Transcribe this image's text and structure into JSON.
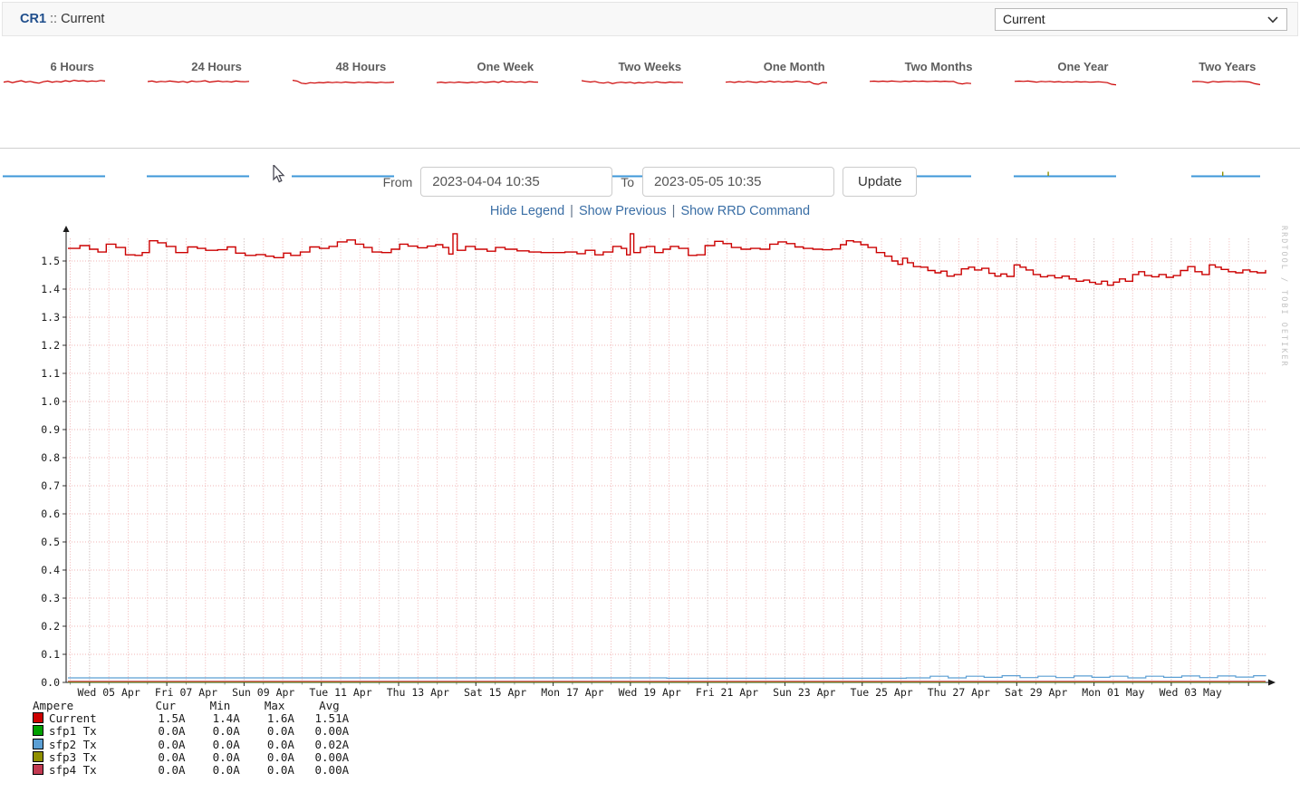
{
  "header": {
    "device": "CR1",
    "sep": "::",
    "page": "Current",
    "range_select_value": "Current"
  },
  "thumbnails": {
    "items": [
      {
        "label": "6 Hours",
        "start_frac": 0,
        "olive_tick": null,
        "spark": [
          0.45,
          0.52,
          0.4,
          0.5,
          0.58,
          0.45,
          0.52,
          0.42,
          0.35,
          0.48,
          0.55,
          0.44,
          0.52,
          0.46,
          0.58,
          0.5,
          0.62,
          0.54,
          0.58,
          0.5,
          0.56,
          0.52,
          0.6,
          0.55
        ]
      },
      {
        "label": "24 Hours",
        "start_frac": 0,
        "olive_tick": null,
        "spark": [
          0.5,
          0.55,
          0.45,
          0.52,
          0.48,
          0.55,
          0.5,
          0.45,
          0.52,
          0.42,
          0.55,
          0.48,
          0.52,
          0.58,
          0.45,
          0.5,
          0.55,
          0.48,
          0.52,
          0.46,
          0.55,
          0.5,
          0.48,
          0.52
        ]
      },
      {
        "label": "48 Hours",
        "start_frac": 0,
        "olive_tick": null,
        "spark": [
          0.62,
          0.55,
          0.35,
          0.3,
          0.4,
          0.36,
          0.42,
          0.38,
          0.45,
          0.4,
          0.44,
          0.4,
          0.46,
          0.42,
          0.38,
          0.44,
          0.4,
          0.45,
          0.42,
          0.38,
          0.44,
          0.4,
          0.42,
          0.45
        ]
      },
      {
        "label": "One Week",
        "start_frac": 0,
        "olive_tick": null,
        "spark": [
          0.4,
          0.45,
          0.38,
          0.44,
          0.4,
          0.46,
          0.42,
          0.38,
          0.45,
          0.4,
          0.48,
          0.42,
          0.46,
          0.5,
          0.42,
          0.55,
          0.45,
          0.5,
          0.44,
          0.48,
          0.42,
          0.5,
          0.46,
          0.44
        ]
      },
      {
        "label": "Two Weeks",
        "start_frac": 0,
        "olive_tick": null,
        "spark": [
          0.58,
          0.52,
          0.46,
          0.52,
          0.4,
          0.36,
          0.44,
          0.32,
          0.4,
          0.44,
          0.38,
          0.44,
          0.34,
          0.42,
          0.36,
          0.44,
          0.4,
          0.48,
          0.42,
          0.38,
          0.46,
          0.42,
          0.44,
          0.4
        ]
      },
      {
        "label": "One Month",
        "start_frac": 0,
        "olive_tick": null,
        "spark": [
          0.44,
          0.48,
          0.42,
          0.5,
          0.44,
          0.52,
          0.46,
          0.42,
          0.5,
          0.44,
          0.54,
          0.46,
          0.52,
          0.44,
          0.5,
          0.46,
          0.54,
          0.48,
          0.44,
          0.5,
          0.3,
          0.25,
          0.42,
          0.38
        ]
      },
      {
        "label": "Two Months",
        "start_frac": 0,
        "olive_tick": null,
        "spark": [
          0.52,
          0.54,
          0.5,
          0.54,
          0.5,
          0.55,
          0.52,
          0.48,
          0.54,
          0.5,
          0.55,
          0.52,
          0.54,
          0.5,
          0.52,
          0.54,
          0.5,
          0.53,
          0.5,
          0.52,
          0.35,
          0.28,
          0.36,
          0.32
        ]
      },
      {
        "label": "One Year",
        "start_frac": 0,
        "olive_tick": 0.34,
        "spark": [
          0.52,
          0.54,
          0.52,
          0.55,
          0.5,
          0.44,
          0.52,
          0.48,
          0.52,
          0.46,
          0.5,
          0.44,
          0.48,
          0.44,
          0.5,
          0.46,
          0.48,
          0.44,
          0.46,
          0.48,
          0.44,
          0.4,
          0.25,
          0.2
        ]
      },
      {
        "label": "Two Years",
        "start_frac": 0.33,
        "olive_tick": 0.64,
        "spark": [
          0.5,
          0.52,
          0.48,
          0.4,
          0.52,
          0.46,
          0.5,
          0.52,
          0.48,
          0.52,
          0.5,
          0.46,
          0.3,
          0.22
        ]
      }
    ]
  },
  "controls": {
    "from_label": "From",
    "from_value": "2023-04-04 10:35",
    "to_label": "To",
    "to_value": "2023-05-05 10:35",
    "update_label": "Update",
    "links": [
      "Hide Legend",
      "Show Previous",
      "Show RRD Command"
    ],
    "links_sep": "|"
  },
  "chart_data": {
    "type": "line",
    "title": "",
    "xlabel": "",
    "ylabel": "",
    "x_range": {
      "start": "2023-04-04 10:35",
      "end": "2023-05-05 10:35",
      "span_days": 31
    },
    "x_axis": {
      "tick_labels": [
        "Wed 05 Apr",
        "Fri 07 Apr",
        "Sun 09 Apr",
        "Tue 11 Apr",
        "Thu 13 Apr",
        "Sat 15 Apr",
        "Mon 17 Apr",
        "Wed 19 Apr",
        "Fri 21 Apr",
        "Sun 23 Apr",
        "Tue 25 Apr",
        "Thu 27 Apr",
        "Sat 29 Apr",
        "Mon 01 May",
        "Wed 03 May"
      ],
      "label_first_day": 1.059,
      "label_step_days": 2,
      "minor_first_day": 0.059,
      "minor_step_days": 0.5,
      "major_first_day": 0.559,
      "major_step_days": 2
    },
    "y_axis": {
      "min": 0,
      "max": 1.58,
      "tick_step": 0.1,
      "tick_top": 1.5,
      "tick_labels": [
        "0.0",
        "0.1",
        "0.2",
        "0.3",
        "0.4",
        "0.5",
        "0.6",
        "0.7",
        "0.8",
        "0.9",
        "1.0",
        "1.1",
        "1.2",
        "1.3",
        "1.4",
        "1.5"
      ]
    },
    "grid": {
      "minor_color": "#f0b4b4",
      "major_color": "#c6c6c6",
      "on": true
    },
    "series": [
      {
        "name": "Current",
        "color": "#cc0000",
        "points": [
          [
            0,
            1.545
          ],
          [
            0.01,
            1.555
          ],
          [
            0.018,
            1.542
          ],
          [
            0.025,
            1.532
          ],
          [
            0.032,
            1.56
          ],
          [
            0.04,
            1.548
          ],
          [
            0.048,
            1.522
          ],
          [
            0.056,
            1.52
          ],
          [
            0.062,
            1.53
          ],
          [
            0.068,
            1.572
          ],
          [
            0.075,
            1.565
          ],
          [
            0.082,
            1.552
          ],
          [
            0.09,
            1.53
          ],
          [
            0.1,
            1.55
          ],
          [
            0.108,
            1.545
          ],
          [
            0.115,
            1.538
          ],
          [
            0.125,
            1.54
          ],
          [
            0.133,
            1.55
          ],
          [
            0.14,
            1.528
          ],
          [
            0.148,
            1.52
          ],
          [
            0.157,
            1.523
          ],
          [
            0.165,
            1.517
          ],
          [
            0.172,
            1.512
          ],
          [
            0.18,
            1.528
          ],
          [
            0.186,
            1.52
          ],
          [
            0.194,
            1.532
          ],
          [
            0.202,
            1.55
          ],
          [
            0.21,
            1.545
          ],
          [
            0.218,
            1.552
          ],
          [
            0.225,
            1.568
          ],
          [
            0.233,
            1.575
          ],
          [
            0.24,
            1.56
          ],
          [
            0.247,
            1.548
          ],
          [
            0.254,
            1.532
          ],
          [
            0.262,
            1.53
          ],
          [
            0.27,
            1.542
          ],
          [
            0.277,
            1.56
          ],
          [
            0.284,
            1.553
          ],
          [
            0.292,
            1.547
          ],
          [
            0.3,
            1.553
          ],
          [
            0.307,
            1.558
          ],
          [
            0.313,
            1.548
          ],
          [
            0.318,
            1.525
          ],
          [
            0.3215,
            1.597
          ],
          [
            0.325,
            1.538
          ],
          [
            0.332,
            1.552
          ],
          [
            0.34,
            1.542
          ],
          [
            0.35,
            1.535
          ],
          [
            0.357,
            1.548
          ],
          [
            0.365,
            1.542
          ],
          [
            0.375,
            1.536
          ],
          [
            0.385,
            1.532
          ],
          [
            0.395,
            1.53
          ],
          [
            0.405,
            1.53
          ],
          [
            0.415,
            1.532
          ],
          [
            0.425,
            1.526
          ],
          [
            0.432,
            1.538
          ],
          [
            0.44,
            1.522
          ],
          [
            0.447,
            1.532
          ],
          [
            0.455,
            1.552
          ],
          [
            0.462,
            1.545
          ],
          [
            0.4665,
            1.522
          ],
          [
            0.4695,
            1.597
          ],
          [
            0.4725,
            1.53
          ],
          [
            0.478,
            1.548
          ],
          [
            0.483,
            1.552
          ],
          [
            0.49,
            1.53
          ],
          [
            0.497,
            1.542
          ],
          [
            0.503,
            1.552
          ],
          [
            0.51,
            1.545
          ],
          [
            0.518,
            1.52
          ],
          [
            0.525,
            1.522
          ],
          [
            0.532,
            1.555
          ],
          [
            0.54,
            1.57
          ],
          [
            0.547,
            1.562
          ],
          [
            0.554,
            1.548
          ],
          [
            0.562,
            1.542
          ],
          [
            0.57,
            1.545
          ],
          [
            0.578,
            1.542
          ],
          [
            0.586,
            1.56
          ],
          [
            0.593,
            1.568
          ],
          [
            0.6,
            1.562
          ],
          [
            0.607,
            1.55
          ],
          [
            0.614,
            1.545
          ],
          [
            0.622,
            1.542
          ],
          [
            0.63,
            1.54
          ],
          [
            0.638,
            1.543
          ],
          [
            0.645,
            1.558
          ],
          [
            0.65,
            1.572
          ],
          [
            0.656,
            1.568
          ],
          [
            0.662,
            1.558
          ],
          [
            0.668,
            1.548
          ],
          [
            0.675,
            1.53
          ],
          [
            0.682,
            1.517
          ],
          [
            0.688,
            1.5
          ],
          [
            0.693,
            1.488
          ],
          [
            0.697,
            1.51
          ],
          [
            0.701,
            1.494
          ],
          [
            0.706,
            1.48
          ],
          [
            0.712,
            1.478
          ],
          [
            0.718,
            1.466
          ],
          [
            0.724,
            1.458
          ],
          [
            0.729,
            1.464
          ],
          [
            0.734,
            1.446
          ],
          [
            0.74,
            1.452
          ],
          [
            0.746,
            1.472
          ],
          [
            0.752,
            1.478
          ],
          [
            0.757,
            1.468
          ],
          [
            0.763,
            1.474
          ],
          [
            0.769,
            1.456
          ],
          [
            0.774,
            1.446
          ],
          [
            0.779,
            1.454
          ],
          [
            0.784,
            1.445
          ],
          [
            0.79,
            1.486
          ],
          [
            0.795,
            1.478
          ],
          [
            0.8,
            1.468
          ],
          [
            0.806,
            1.452
          ],
          [
            0.812,
            1.444
          ],
          [
            0.818,
            1.448
          ],
          [
            0.824,
            1.44
          ],
          [
            0.83,
            1.446
          ],
          [
            0.836,
            1.436
          ],
          [
            0.842,
            1.428
          ],
          [
            0.848,
            1.432
          ],
          [
            0.853,
            1.424
          ],
          [
            0.858,
            1.418
          ],
          [
            0.863,
            1.428
          ],
          [
            0.868,
            1.414
          ],
          [
            0.873,
            1.425
          ],
          [
            0.878,
            1.436
          ],
          [
            0.883,
            1.428
          ],
          [
            0.889,
            1.452
          ],
          [
            0.894,
            1.462
          ],
          [
            0.899,
            1.448
          ],
          [
            0.905,
            1.444
          ],
          [
            0.911,
            1.452
          ],
          [
            0.917,
            1.442
          ],
          [
            0.923,
            1.448
          ],
          [
            0.929,
            1.466
          ],
          [
            0.935,
            1.48
          ],
          [
            0.941,
            1.462
          ],
          [
            0.947,
            1.452
          ],
          [
            0.953,
            1.486
          ],
          [
            0.958,
            1.478
          ],
          [
            0.963,
            1.47
          ],
          [
            0.969,
            1.462
          ],
          [
            0.975,
            1.458
          ],
          [
            0.981,
            1.468
          ],
          [
            0.987,
            1.462
          ],
          [
            0.993,
            1.458
          ],
          [
            1,
            1.468
          ]
        ]
      },
      {
        "name": "sfp1 Tx",
        "color": "#00a000",
        "points": [
          [
            0,
            0.001
          ],
          [
            1,
            0.001
          ]
        ]
      },
      {
        "name": "sfp2 Tx",
        "color": "#5b9fd4",
        "points": [
          [
            0,
            0.016
          ],
          [
            0.3,
            0.016
          ],
          [
            0.5,
            0.015
          ],
          [
            0.7,
            0.016
          ],
          [
            0.72,
            0.022
          ],
          [
            0.735,
            0.016
          ],
          [
            0.75,
            0.022
          ],
          [
            0.765,
            0.018
          ],
          [
            0.78,
            0.024
          ],
          [
            0.795,
            0.017
          ],
          [
            0.81,
            0.022
          ],
          [
            0.825,
            0.017
          ],
          [
            0.84,
            0.023
          ],
          [
            0.855,
            0.018
          ],
          [
            0.87,
            0.022
          ],
          [
            0.885,
            0.016
          ],
          [
            0.9,
            0.022
          ],
          [
            0.915,
            0.018
          ],
          [
            0.93,
            0.023
          ],
          [
            0.945,
            0.017
          ],
          [
            0.96,
            0.023
          ],
          [
            0.975,
            0.019
          ],
          [
            0.99,
            0.024
          ],
          [
            1,
            0.022
          ]
        ]
      },
      {
        "name": "sfp3 Tx",
        "color": "#8f8f00",
        "points": [
          [
            0,
            0.002
          ],
          [
            1,
            0.002
          ]
        ]
      },
      {
        "name": "sfp4 Tx",
        "color": "#c23a52",
        "points": [
          [
            0,
            0.004
          ],
          [
            1,
            0.004
          ]
        ]
      }
    ]
  },
  "legend": {
    "unit_header": "Ampere",
    "columns": [
      "Cur",
      "Min",
      "Max",
      "Avg"
    ],
    "rows": [
      {
        "label": "Current",
        "color": "#cc0000",
        "values": [
          "1.5A",
          "1.4A",
          "1.6A",
          "1.51A"
        ]
      },
      {
        "label": "sfp1 Tx",
        "color": "#00a000",
        "values": [
          "0.0A",
          "0.0A",
          "0.0A",
          "0.00A"
        ]
      },
      {
        "label": "sfp2 Tx",
        "color": "#5b9fd4",
        "values": [
          "0.0A",
          "0.0A",
          "0.0A",
          "0.02A"
        ]
      },
      {
        "label": "sfp3 Tx",
        "color": "#8f8f00",
        "values": [
          "0.0A",
          "0.0A",
          "0.0A",
          "0.00A"
        ]
      },
      {
        "label": "sfp4 Tx",
        "color": "#c23a52",
        "values": [
          "0.0A",
          "0.0A",
          "0.0A",
          "0.00A"
        ]
      }
    ]
  },
  "watermark": "RRDTOOL / TOBI OETIKER"
}
